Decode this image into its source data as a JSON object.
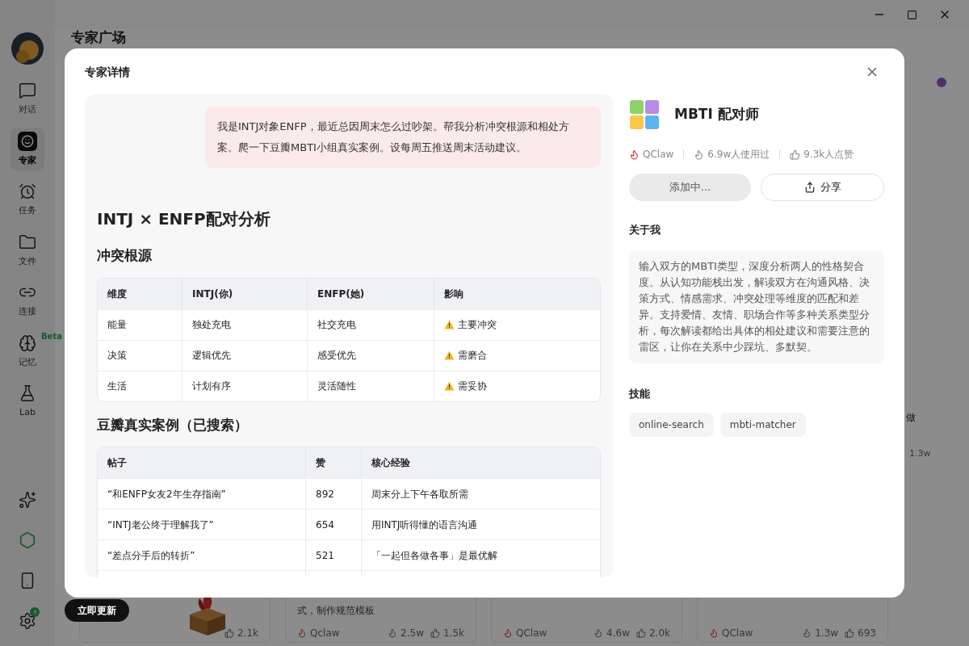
{
  "sidebar": {
    "items": [
      {
        "label": "对话",
        "selected": false
      },
      {
        "label": "专家",
        "selected": true
      },
      {
        "label": "任务",
        "selected": false
      },
      {
        "label": "文件",
        "selected": false
      },
      {
        "label": "连接",
        "selected": false
      },
      {
        "label": "记忆",
        "selected": false,
        "badge": "Beta"
      },
      {
        "label": "Lab",
        "selected": false
      }
    ]
  },
  "page_title": "专家广场",
  "update_button": "立即更新",
  "cards": [
    {
      "likes": "2.1k",
      "kind": "picture"
    },
    {
      "desc": "式，制作规范模板",
      "author": "Qclaw",
      "uses": "2.5w",
      "likes": "1.5k",
      "kind": "text"
    },
    {
      "author": "QClaw",
      "uses": "4.6w",
      "likes": "2.0k",
      "kind": "text"
    },
    {
      "author": "QClaw",
      "uses": "1.3w",
      "likes": "693",
      "kind": "text"
    }
  ],
  "right_peek": {
    "text": "做",
    "count": "1.3w"
  },
  "modal": {
    "title": "专家详情",
    "prompt": "我是INTJ对象ENFP，最近总因周末怎么过吵架。帮我分析冲突根源和相处方案。爬一下豆瓣MBTI小组真实案例。设每周五推送周末活动建议。",
    "report_title": "INTJ × ENFP配对分析",
    "sections": [
      {
        "heading": "冲突根源",
        "columns": [
          "维度",
          "INTJ(你)",
          "ENFP(她)",
          "影响"
        ],
        "rows": [
          {
            "cells": [
              "能量",
              "独处充电",
              "社交充电",
              "主要冲突"
            ],
            "warning": true
          },
          {
            "cells": [
              "决策",
              "逻辑优先",
              "感受优先",
              "需磨合"
            ],
            "warning": true
          },
          {
            "cells": [
              "生活",
              "计划有序",
              "灵活随性",
              "需妥协"
            ],
            "warning": true
          }
        ]
      },
      {
        "heading": "豆瓣真实案例（已搜索）",
        "columns": [
          "帖子",
          "赞",
          "核心经验"
        ],
        "rows": [
          {
            "cells": [
              "“和ENFP女友2年生存指南”",
              "892",
              "周末分上下午各取所需"
            ],
            "warning": false
          },
          {
            "cells": [
              "“INTJ老公终于理解我了”",
              "654",
              "用INTJ听得懂的语言沟通"
            ],
            "warning": false
          },
          {
            "cells": [
              "“差点分手后的转折”",
              "521",
              "「一起但各做各事」是最优解"
            ],
            "warning": false
          }
        ]
      }
    ]
  },
  "expert": {
    "name": "MBTI 配对师",
    "author": "QClaw",
    "uses": "6.9w人使用过",
    "likes": "9.3k人点赞",
    "add_button": {
      "label": "添加中...",
      "disabled": true
    },
    "share_button": "分享",
    "about_heading": "关于我",
    "about": "输入双方的MBTI类型，深度分析两人的性格契合度。从认知功能栈出发，解读双方在沟通风格、决策方式、情感需求、冲突处理等维度的匹配和差异。支持爱情、友情、职场合作等多种关系类型分析，每次解读都给出具体的相处建议和需要注意的雷区，让你在关系中少踩坑、多默契。",
    "skills_heading": "技能",
    "skills": [
      "online-search",
      "mbti-matcher"
    ]
  }
}
